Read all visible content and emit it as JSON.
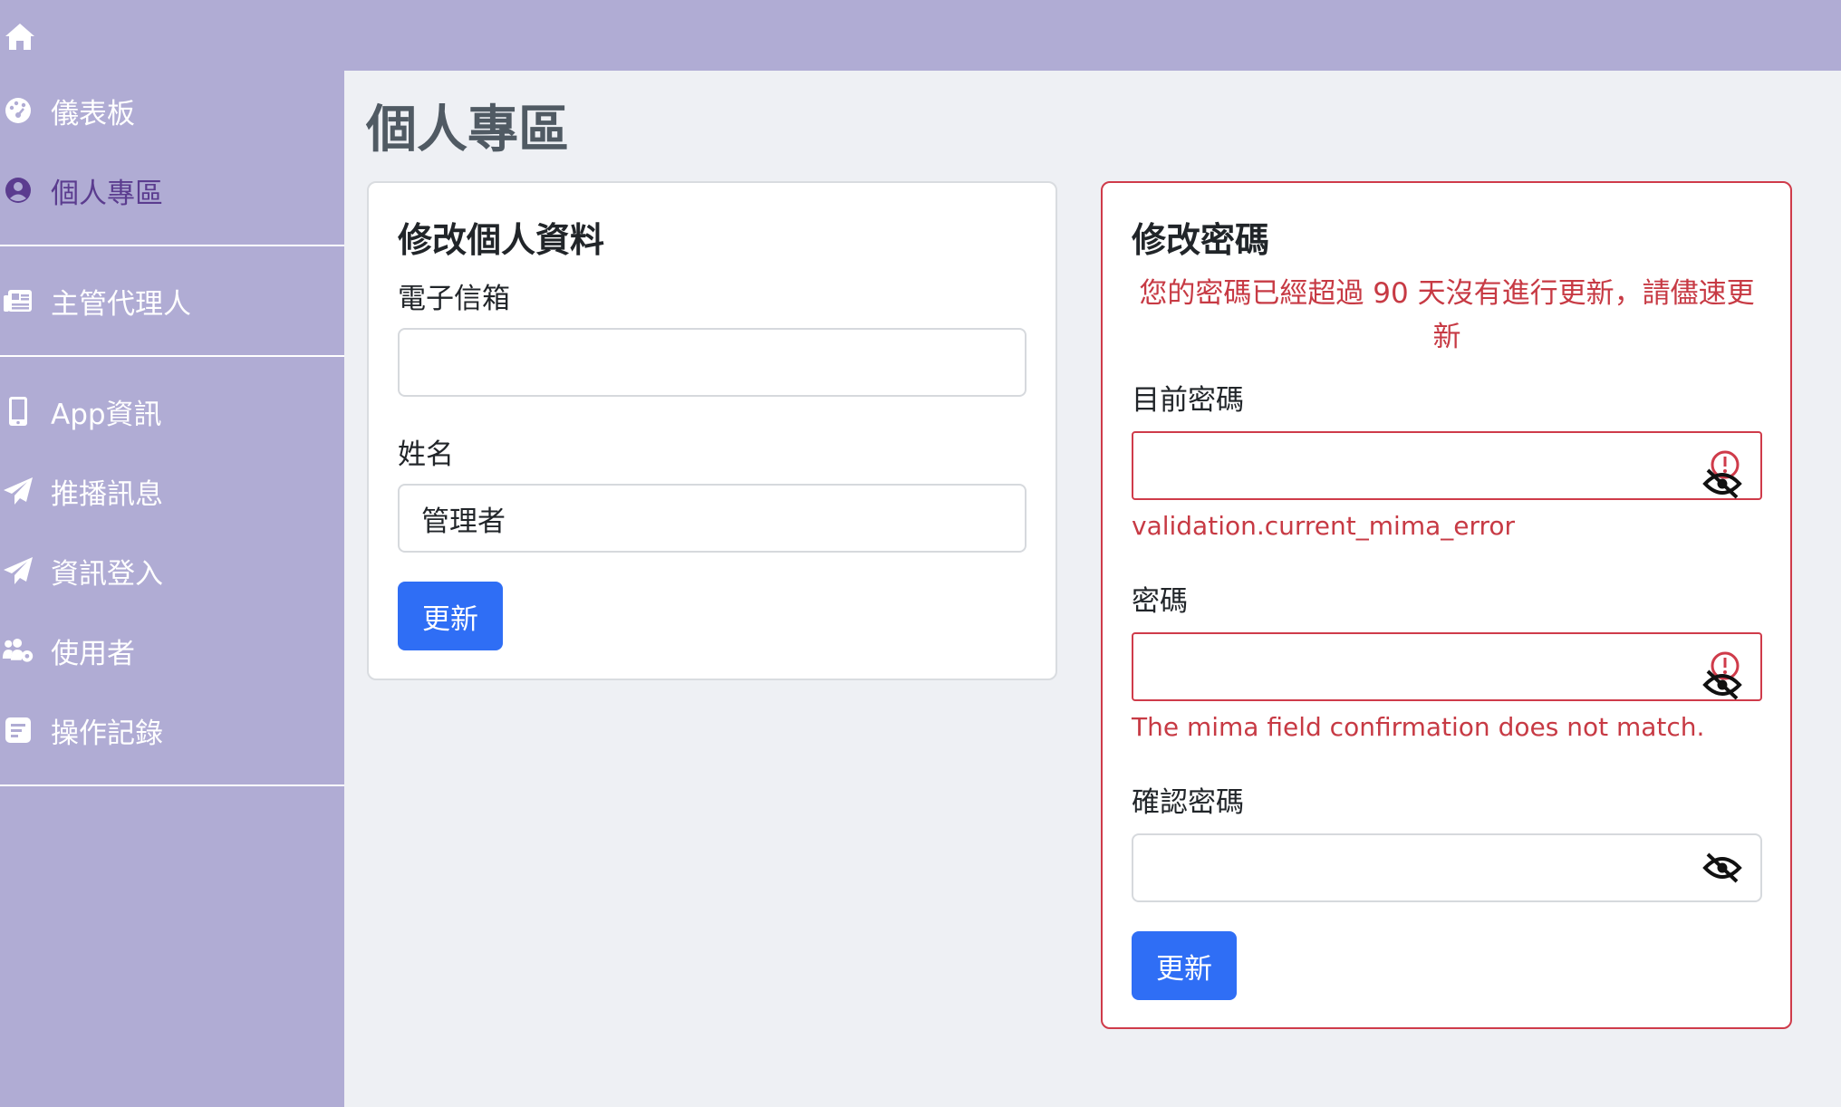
{
  "nav": {
    "home_icon": "home-icon",
    "items": [
      {
        "label": "儀表板",
        "icon": "dashboard-icon"
      },
      {
        "label": "個人專區",
        "icon": "user-circle-icon",
        "active": true
      },
      {
        "label": "主管代理人",
        "icon": "newspaper-icon"
      },
      {
        "label": "App資訊",
        "icon": "mobile-icon"
      },
      {
        "label": "推播訊息",
        "icon": "paper-plane-icon"
      },
      {
        "label": "資訊登入",
        "icon": "paper-plane-icon"
      },
      {
        "label": "使用者",
        "icon": "users-gear-icon"
      },
      {
        "label": "操作記錄",
        "icon": "log-icon"
      }
    ]
  },
  "page": {
    "title": "個人專區"
  },
  "profile_card": {
    "title": "修改個人資料",
    "email_label": "電子信箱",
    "email_value": "",
    "name_label": "姓名",
    "name_value": "管理者",
    "submit_label": "更新"
  },
  "password_card": {
    "title": "修改密碼",
    "warning_line1": "您的密碼已經超過 90 天沒有進行更新，請儘速更",
    "warning_line2": "新",
    "current_label": "目前密碼",
    "current_error": "validation.current_mima_error",
    "new_label": "密碼",
    "new_error": "The mima field confirmation does not match.",
    "confirm_label": "確認密碼",
    "submit_label": "更新"
  },
  "colors": {
    "sidebar": "#b0acd4",
    "active_nav": "#5b3c8f",
    "primary": "#2f6ef5",
    "danger": "#cf3b4a",
    "background": "#eef0f4"
  }
}
